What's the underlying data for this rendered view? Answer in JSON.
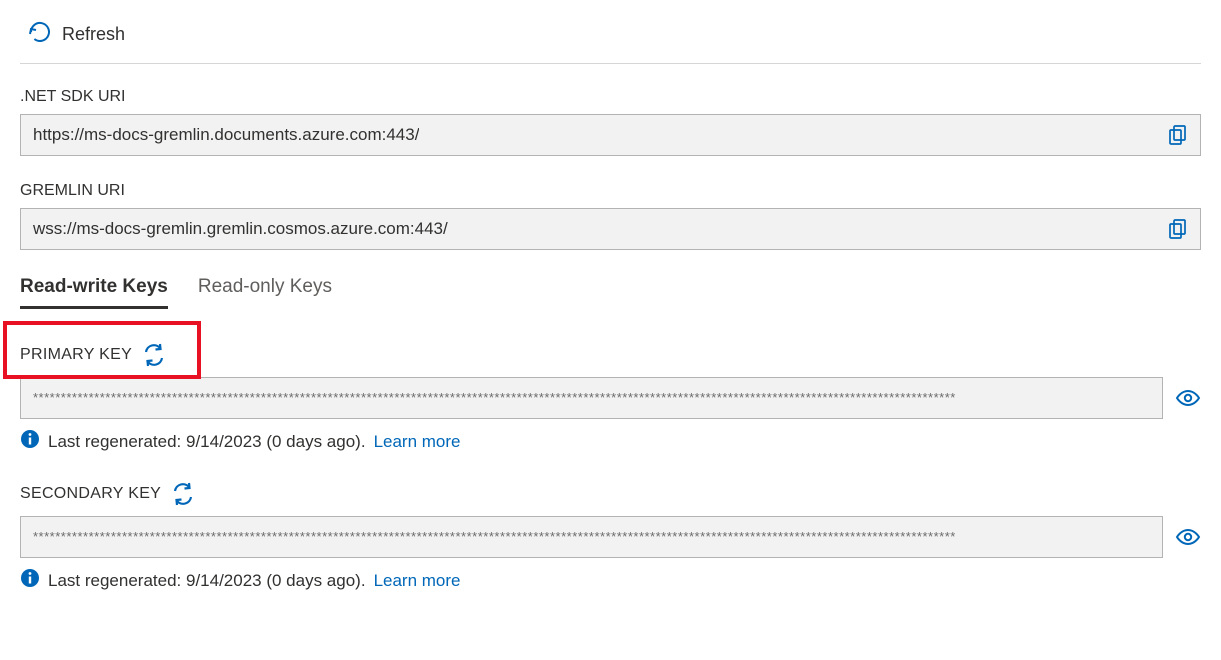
{
  "toolbar": {
    "refresh": "Refresh"
  },
  "fields": {
    "net_sdk_uri": {
      "label": ".NET SDK URI",
      "value": "https://ms-docs-gremlin.documents.azure.com:443/"
    },
    "gremlin_uri": {
      "label": "GREMLIN URI",
      "value": "wss://ms-docs-gremlin.gremlin.cosmos.azure.com:443/"
    }
  },
  "tabs": {
    "rw": "Read-write Keys",
    "ro": "Read-only Keys",
    "active": "rw"
  },
  "keys": {
    "primary": {
      "label": "PRIMARY KEY",
      "masked": "**********************************************************************************************************************************************************************",
      "info_prefix": "Last regenerated: ",
      "info_date": "9/14/2023 (0 days ago). ",
      "learn": "Learn more"
    },
    "secondary": {
      "label": "SECONDARY KEY",
      "masked": "**********************************************************************************************************************************************************************",
      "info_prefix": "Last regenerated: ",
      "info_date": "9/14/2023 (0 days ago). ",
      "learn": "Learn more"
    }
  }
}
